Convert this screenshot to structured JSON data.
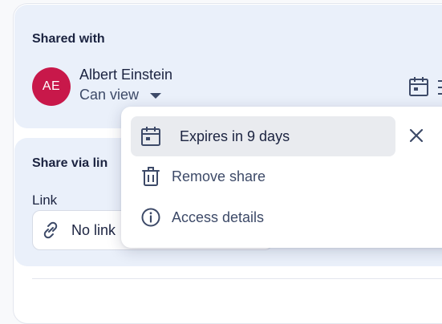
{
  "shared": {
    "title": "Shared with",
    "user": {
      "initials": "AE",
      "name": "Albert Einstein",
      "permission": "Can view"
    }
  },
  "share_link": {
    "title": "Share via lin",
    "link_label": "Link",
    "link_value": "No link"
  },
  "menu": {
    "items": [
      {
        "label": "Expires in 9 days",
        "icon": "calendar-icon",
        "selected": true
      },
      {
        "label": "Remove share",
        "icon": "trash-icon"
      },
      {
        "label": "Access details",
        "icon": "info-icon"
      }
    ],
    "close_icon": "close-icon"
  },
  "colors": {
    "avatar": "#c8184a",
    "card_bg": "#eaf0fa",
    "text_primary": "#1b2340",
    "text_secondary": "#3d4a68"
  }
}
